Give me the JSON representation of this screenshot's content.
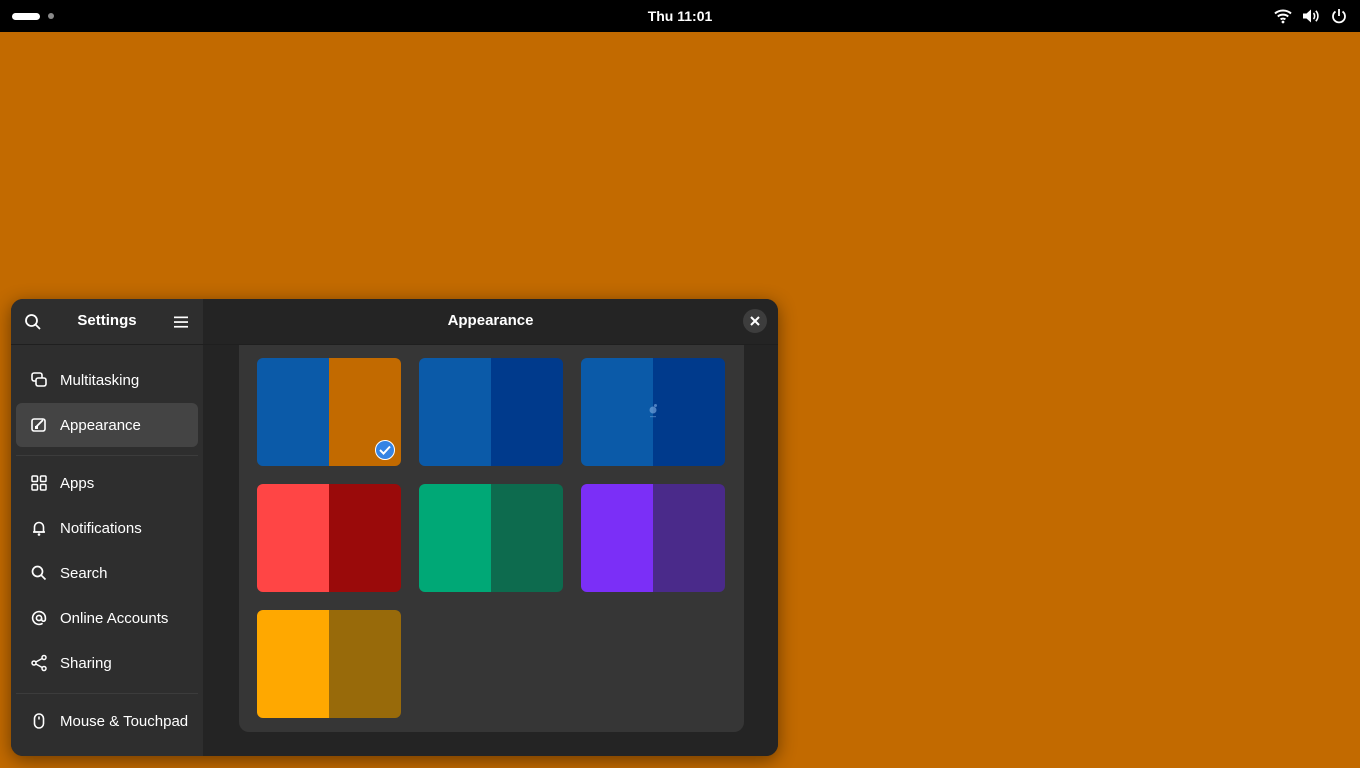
{
  "topbar": {
    "clock": "Thu 11:01",
    "tray_icons": [
      "wifi-icon",
      "volume-icon",
      "power-icon"
    ]
  },
  "window": {
    "sidebar": {
      "title": "Settings",
      "items": [
        {
          "label": "Multitasking",
          "icon": "multitasking-icon"
        },
        {
          "label": "Appearance",
          "icon": "appearance-icon",
          "active": true
        },
        {
          "label": "Apps",
          "icon": "apps-grid-icon"
        },
        {
          "label": "Notifications",
          "icon": "bell-icon"
        },
        {
          "label": "Search",
          "icon": "search-icon"
        },
        {
          "label": "Online Accounts",
          "icon": "at-sign-icon"
        },
        {
          "label": "Sharing",
          "icon": "share-icon"
        },
        {
          "label": "Mouse & Touchpad",
          "icon": "mouse-icon"
        }
      ]
    },
    "main": {
      "title": "Appearance",
      "backgrounds": [
        {
          "left": "#0b5aa8",
          "right": "#c26a00",
          "selected": true
        },
        {
          "left": "#0b5aa8",
          "right": "#003a8c"
        },
        {
          "left": "#0b5aa8",
          "right": "#003a8c",
          "logo": true
        },
        {
          "left": "#ff4545",
          "right": "#9a0a0a"
        },
        {
          "left": "#00a876",
          "right": "#0d6b4e"
        },
        {
          "left": "#7b2ff7",
          "right": "#4a2a8a"
        },
        {
          "left": "#ffa800",
          "right": "#986a0a"
        }
      ]
    }
  },
  "colors": {
    "desktop": "#c26a00",
    "accent": "#3584e4"
  }
}
